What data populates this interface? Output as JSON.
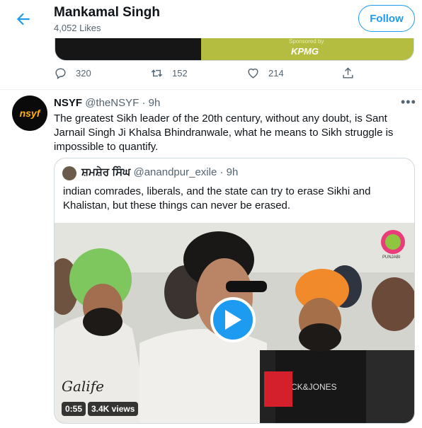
{
  "header": {
    "title": "Mankamal Singh",
    "likes": "4,052 Likes",
    "follow_label": "Follow",
    "back_icon": "back-arrow-icon",
    "accent": "#1d9bf0"
  },
  "previous_tweet": {
    "media_sponsor": "Sponsored by",
    "media_brand": "KPMG",
    "replies": "320",
    "retweets": "152",
    "likes": "214"
  },
  "tweet": {
    "name": "NSYF",
    "handle": "@theNSYF",
    "time": "· 9h",
    "avatar_text": "nsyf",
    "text": "The greatest Sikh leader of the 20th century, without any doubt, is Sant Jarnail Singh Ji Khalsa Bhindranwale, what he means to Sikh struggle is impossible to quantify.",
    "more_label": "•••"
  },
  "quote": {
    "name": "ਸ਼ਮਸ਼ੇਰ ਸਿੰਘ",
    "handle": "@anandpur_exile",
    "time": "· 9h",
    "text": "indian comrades, liberals, and the state can try to erase Sikhi and Khalistan, but these things can never be erased.",
    "video": {
      "duration": "0:55",
      "views": "3.4K views",
      "play_icon": "play-icon",
      "shirt_text": "Galife",
      "jersey_text": "JACK&JONES",
      "channel_logo": "PUNJABI"
    }
  }
}
